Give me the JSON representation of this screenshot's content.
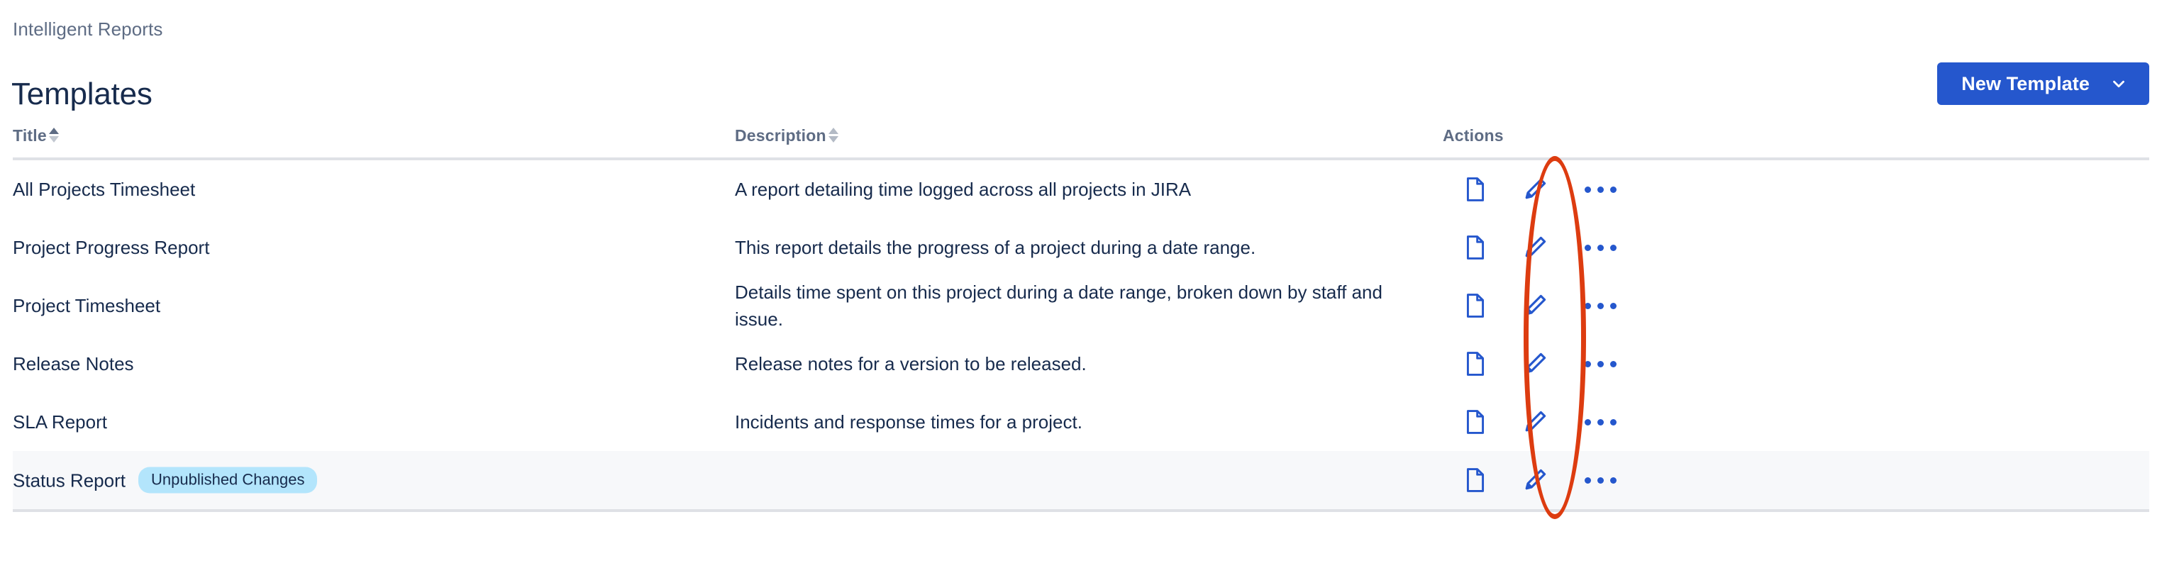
{
  "breadcrumb": "Intelligent Reports",
  "page_title": "Templates",
  "toolbar": {
    "new_template_label": "New Template",
    "new_template_icon": "chevron-down-icon"
  },
  "colors": {
    "primary_blue": "#2557cd",
    "text": "#172b4d",
    "muted_text": "#5e6c84",
    "border": "#dfe1e6",
    "row_highlight": "#f7f8fa",
    "badge_bg": "#b3e5fc",
    "annotation_red": "#dd3c10"
  },
  "table": {
    "columns": [
      {
        "key": "title",
        "label": "Title",
        "sortable": true,
        "sort": "asc"
      },
      {
        "key": "description",
        "label": "Description",
        "sortable": true,
        "sort": "none"
      },
      {
        "key": "actions",
        "label": "Actions",
        "sortable": false,
        "sort": "none"
      }
    ],
    "row_actions": [
      {
        "name": "document-icon",
        "label": "Document"
      },
      {
        "name": "edit-pencil-icon",
        "label": "Edit"
      },
      {
        "name": "more-options-icon",
        "label": "More"
      }
    ],
    "rows": [
      {
        "title": "All Projects Timesheet",
        "badge": "",
        "description": "A report detailing time logged across all projects in JIRA",
        "highlight": false
      },
      {
        "title": "Project Progress Report",
        "badge": "",
        "description": "This report details the progress of a project during a date range.",
        "highlight": false
      },
      {
        "title": "Project Timesheet",
        "badge": "",
        "description": "Details time spent on this project during a date range, broken down by staff and issue.",
        "highlight": false
      },
      {
        "title": "Release Notes",
        "badge": "",
        "description": "Release notes for a version to be released.",
        "highlight": false
      },
      {
        "title": "SLA Report",
        "badge": "",
        "description": "Incidents and response times for a project.",
        "highlight": false
      },
      {
        "title": "Status Report",
        "badge": "Unpublished Changes",
        "description": "",
        "highlight": true
      }
    ]
  },
  "annotation": {
    "shape": "ellipse",
    "target": "edit-pencil-icon-column",
    "color": "#dd3c10"
  }
}
